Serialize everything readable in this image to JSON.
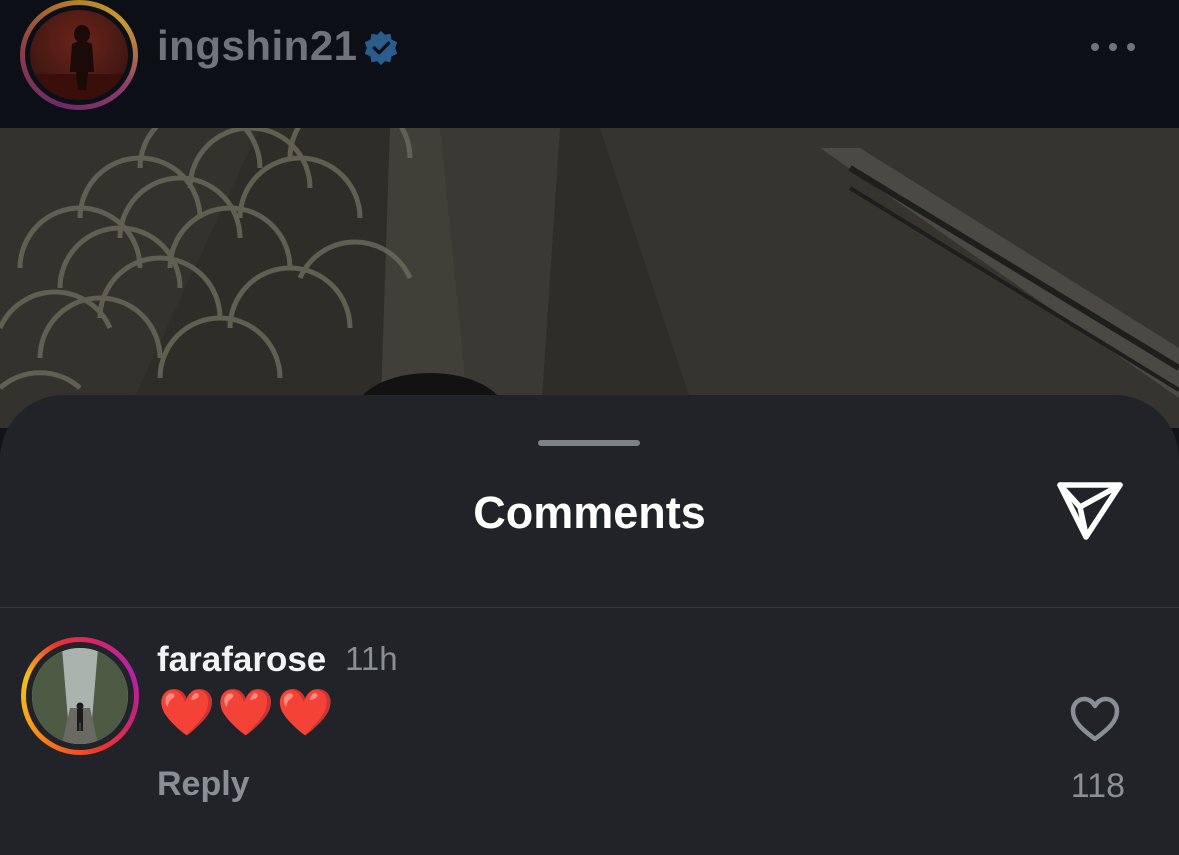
{
  "post_header": {
    "username": "ingshin21",
    "verified": true,
    "more_icon": "ellipsis-icon"
  },
  "comments_sheet": {
    "title": "Comments",
    "share_icon": "paper-plane-icon"
  },
  "comments": [
    {
      "username": "farafarose",
      "time": "11h",
      "text": "❤️❤️❤️",
      "reply_label": "Reply",
      "like_icon": "heart-outline-icon",
      "like_count": "118"
    }
  ],
  "colors": {
    "header_bg": "#0c0f16",
    "sheet_bg": "#212328",
    "verified_badge": "#2a5c8c",
    "muted_text": "#8a8e95"
  }
}
